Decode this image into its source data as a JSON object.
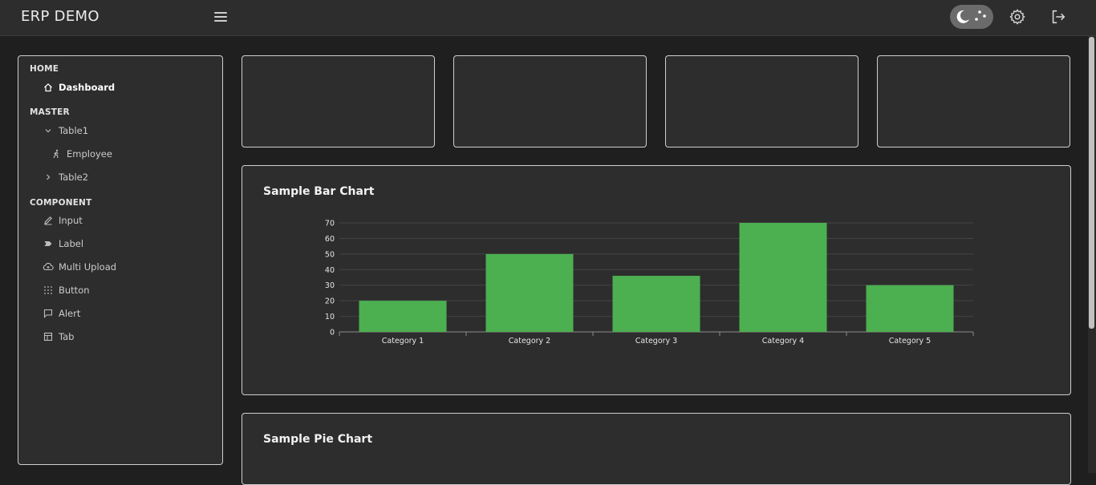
{
  "header": {
    "title": "ERP DEMO"
  },
  "sidebar": {
    "sections": [
      {
        "title": "HOME"
      },
      {
        "title": "MASTER"
      },
      {
        "title": "COMPONENT"
      }
    ],
    "items": {
      "dashboard": "Dashboard",
      "table1": "Table1",
      "employee": "Employee",
      "table2": "Table2",
      "input": "Input",
      "label": "Label",
      "multi_upload": "Multi Upload",
      "button": "Button",
      "alert": "Alert",
      "tab": "Tab"
    }
  },
  "panels": {
    "bar_title": "Sample Bar Chart",
    "pie_title": "Sample Pie Chart"
  },
  "colors": {
    "bar": "#4caf50",
    "accent_text": "#ffffff"
  },
  "chart_data": {
    "type": "bar",
    "title": "Sample Bar Chart",
    "categories": [
      "Category 1",
      "Category 2",
      "Category 3",
      "Category 4",
      "Category 5"
    ],
    "values": [
      20,
      50,
      36,
      70,
      30
    ],
    "ylim": [
      0,
      70
    ],
    "yticks": [
      0,
      10,
      20,
      30,
      40,
      50,
      60,
      70
    ],
    "grid": true,
    "xlabel": "",
    "ylabel": ""
  }
}
